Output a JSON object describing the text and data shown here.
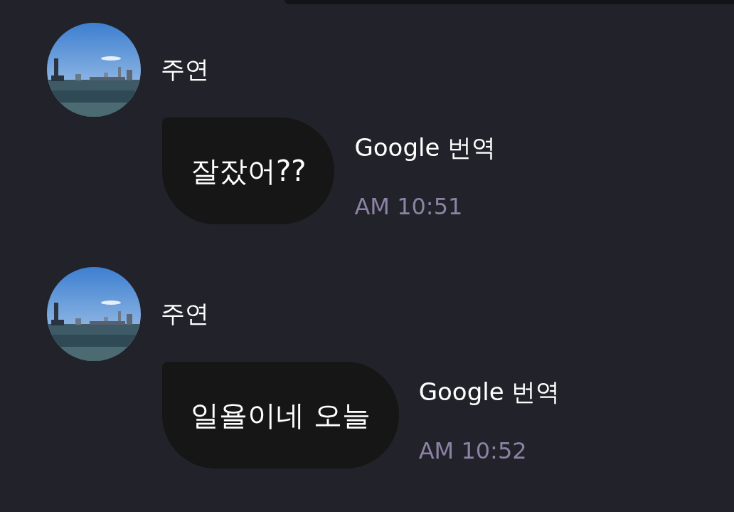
{
  "messages": [
    {
      "sender": "주연",
      "text": "잘잤어??",
      "translate_link": "Google 번역",
      "time": "AM 10:51"
    },
    {
      "sender": "주연",
      "text": "일욜이네 오늘",
      "translate_link": "Google 번역",
      "time": "AM 10:52"
    }
  ]
}
